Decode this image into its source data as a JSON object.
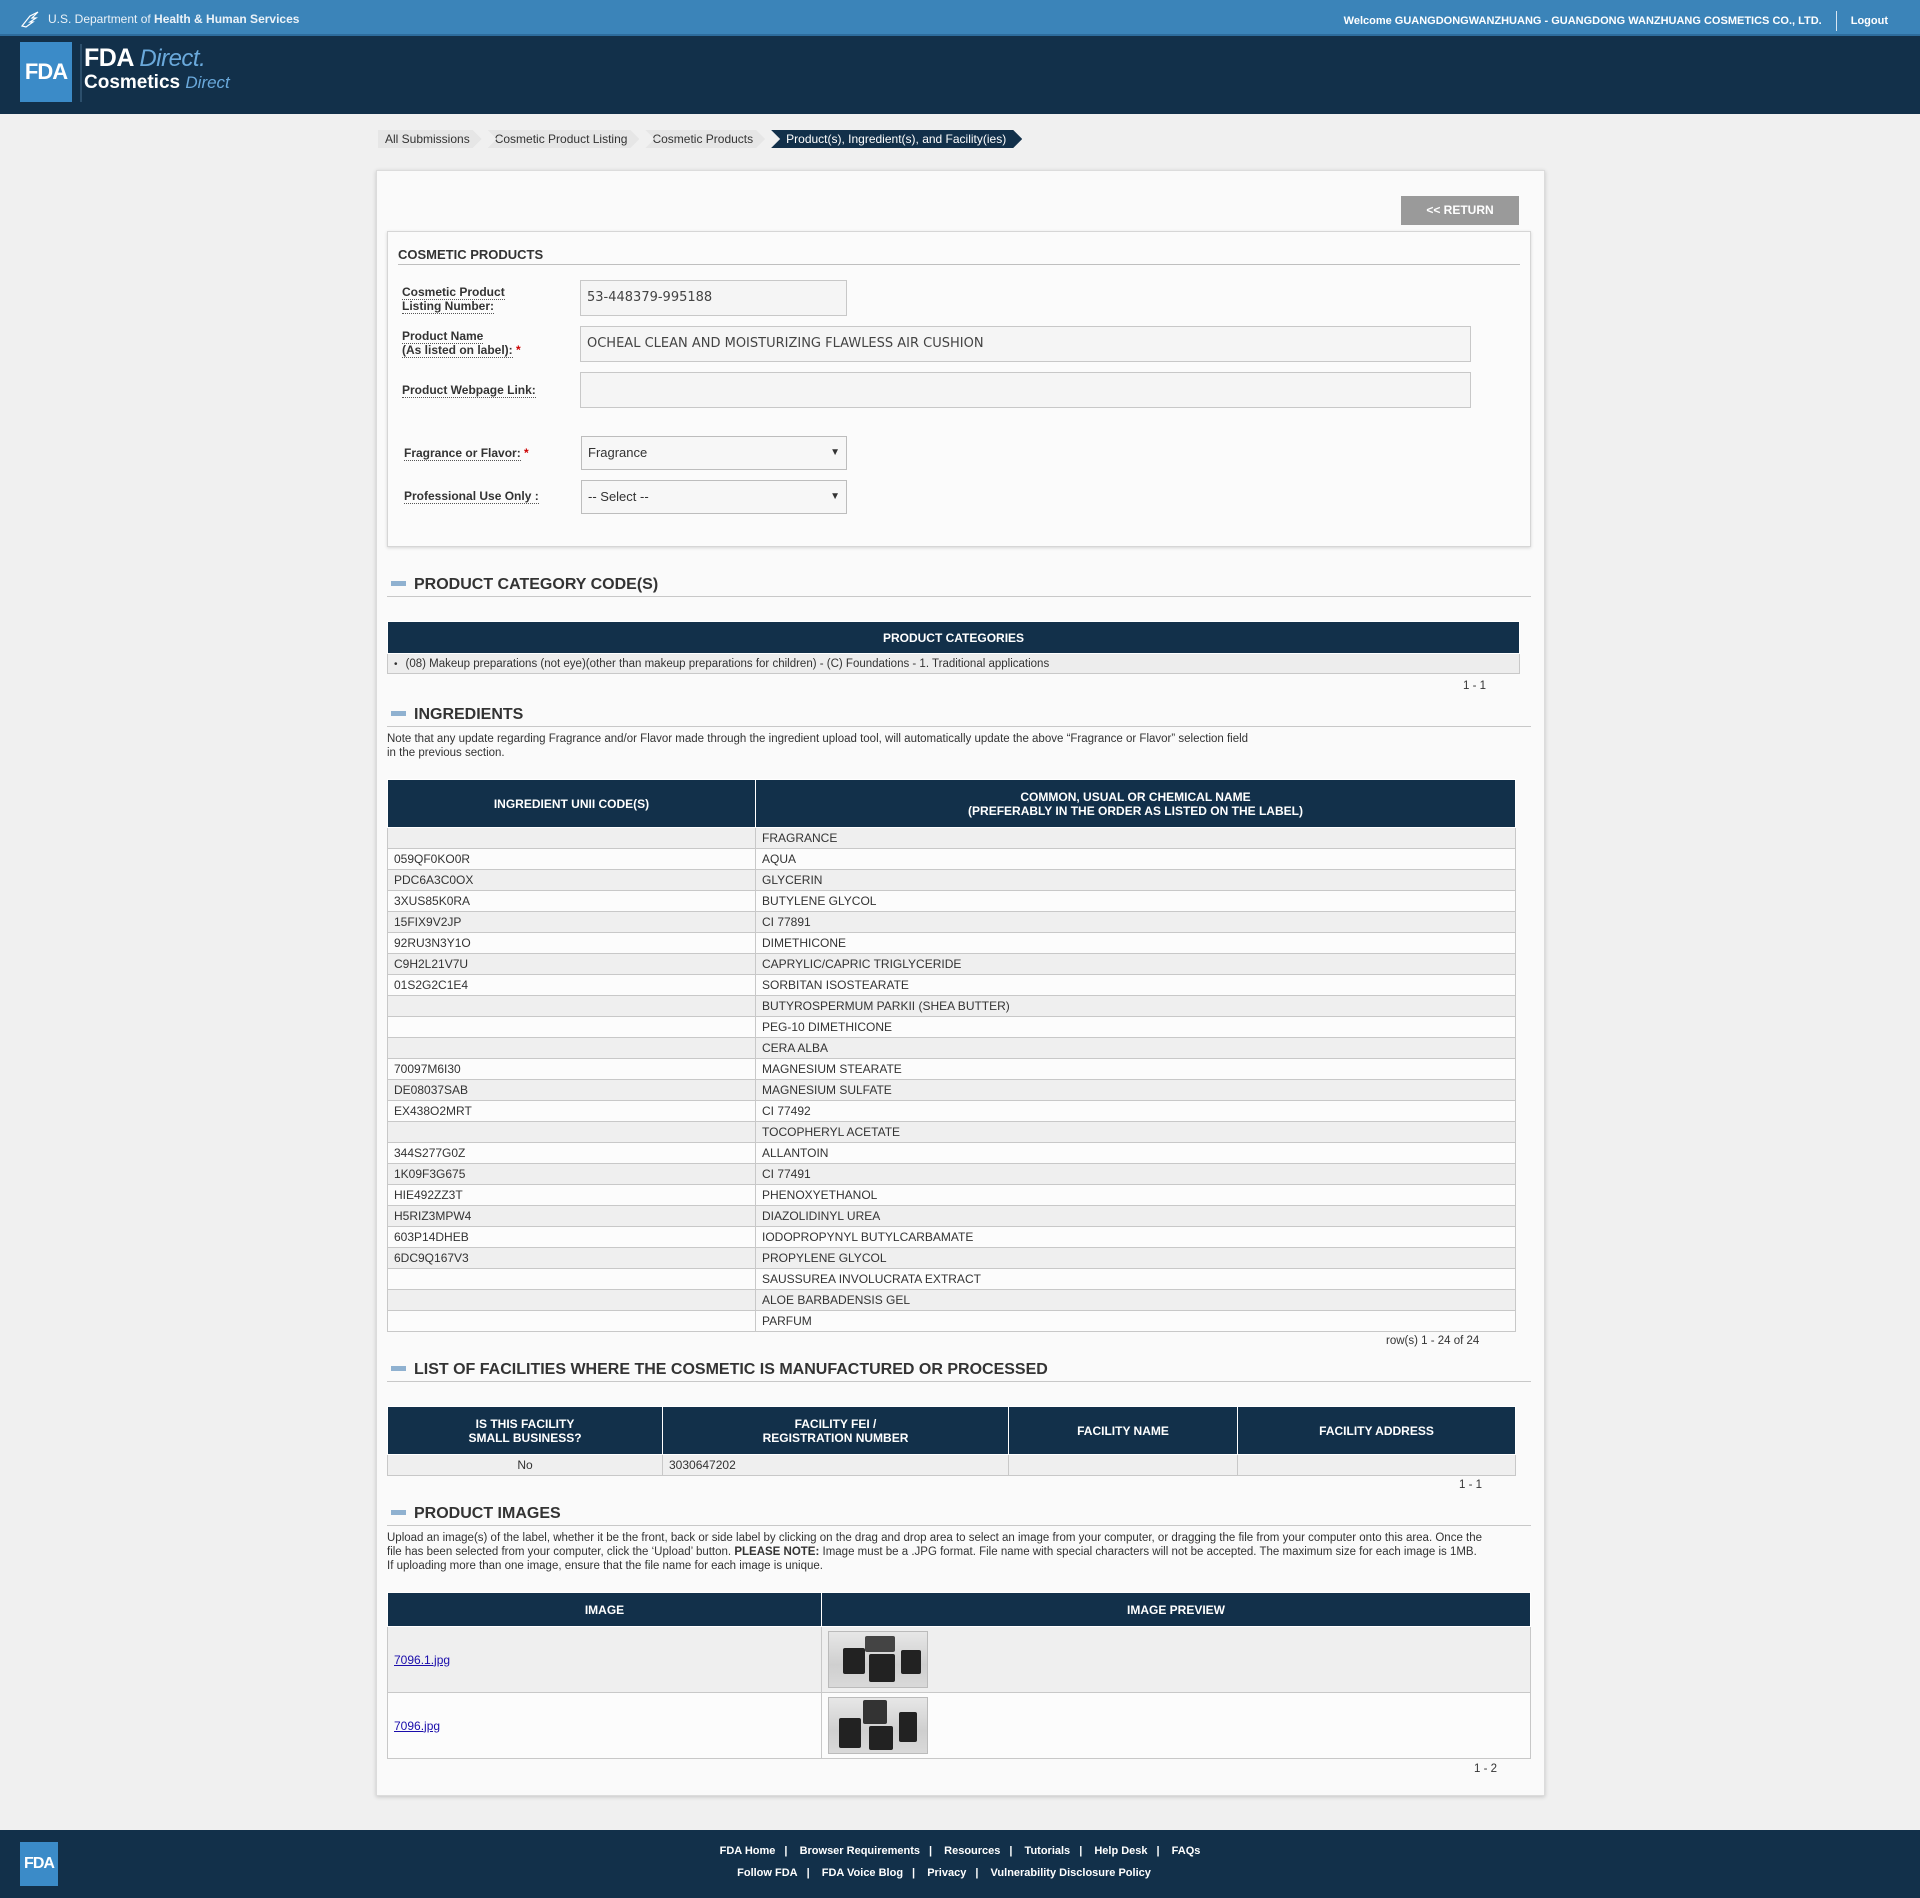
{
  "topbar": {
    "agency_prefix": "U.S. Department of ",
    "agency_name": "Health & Human Services",
    "welcome": "Welcome GUANGDONGWANZHUANG - GUANGDONG WANZHUANG COSMETICS CO., LTD.",
    "logout": "Logout"
  },
  "header": {
    "logo_text": "FDA",
    "brand_line1_a": "FDA",
    "brand_line1_b": "Direct",
    "brand_line1_c": ".",
    "brand_line2_a": "Cosmetics",
    "brand_line2_b": "Direct"
  },
  "breadcrumb": [
    "All Submissions",
    "Cosmetic Product Listing",
    "Cosmetic Products",
    "Product(s), Ingredient(s), and Facility(ies)"
  ],
  "return_label": "<< RETURN",
  "form": {
    "title": "COSMETIC PRODUCTS",
    "listing_label_1": "Cosmetic Product",
    "listing_label_2": "Listing Number:",
    "listing_value": "53-448379-995188",
    "product_name_label_1": "Product Name",
    "product_name_label_2": "(As listed on label):",
    "product_name_value": "OCHEAL CLEAN AND MOISTURIZING FLAWLESS AIR CUSHION",
    "webpage_label": "Product Webpage Link:",
    "webpage_value": "",
    "fragrance_label": "Fragrance or Flavor:",
    "fragrance_value": "Fragrance",
    "professional_label": "Professional Use Only :",
    "professional_value": "-- Select --",
    "required_mark": "*"
  },
  "categories": {
    "section_title": "PRODUCT CATEGORY CODE(S)",
    "header": "PRODUCT CATEGORIES",
    "items": [
      "(08) Makeup preparations (not eye)(other than makeup preparations for children) - (C) Foundations - 1. Traditional applications"
    ],
    "pager": "1 - 1"
  },
  "ingredients": {
    "section_title": "INGREDIENTS",
    "note_line1": "Note that any update regarding Fragrance and/or Flavor made through the ingredient upload tool, will automatically update the above “Fragrance or Flavor” selection field",
    "note_line2": "in the previous section.",
    "col1": "INGREDIENT UNII CODE(S)",
    "col2_line1": "COMMON, USUAL OR CHEMICAL NAME",
    "col2_line2": "(PREFERABLY IN THE ORDER AS LISTED ON THE LABEL)",
    "rows": [
      [
        "",
        "FRAGRANCE"
      ],
      [
        "059QF0KO0R",
        "AQUA"
      ],
      [
        "PDC6A3C0OX",
        "GLYCERIN"
      ],
      [
        "3XUS85K0RA",
        "BUTYLENE GLYCOL"
      ],
      [
        "15FIX9V2JP",
        "CI 77891"
      ],
      [
        "92RU3N3Y1O",
        "DIMETHICONE"
      ],
      [
        "C9H2L21V7U",
        "CAPRYLIC/CAPRIC TRIGLYCERIDE"
      ],
      [
        "01S2G2C1E4",
        "SORBITAN ISOSTEARATE"
      ],
      [
        "",
        "BUTYROSPERMUM PARKII (SHEA BUTTER)"
      ],
      [
        "",
        "PEG-10 DIMETHICONE"
      ],
      [
        "",
        "CERA ALBA"
      ],
      [
        "70097M6I30",
        "MAGNESIUM STEARATE"
      ],
      [
        "DE08037SAB",
        "MAGNESIUM SULFATE"
      ],
      [
        "EX438O2MRT",
        "CI 77492"
      ],
      [
        "",
        "TOCOPHERYL ACETATE"
      ],
      [
        "344S277G0Z",
        "ALLANTOIN"
      ],
      [
        "1K09F3G675",
        "CI 77491"
      ],
      [
        "HIE492ZZ3T",
        "PHENOXYETHANOL"
      ],
      [
        "H5RIZ3MPW4",
        "DIAZOLIDINYL UREA"
      ],
      [
        "603P14DHEB",
        "IODOPROPYNYL BUTYLCARBAMATE"
      ],
      [
        "6DC9Q167V3",
        "PROPYLENE GLYCOL"
      ],
      [
        "",
        "SAUSSUREA INVOLUCRATA EXTRACT"
      ],
      [
        "",
        "ALOE BARBADENSIS GEL"
      ],
      [
        "",
        "PARFUM"
      ]
    ],
    "pager": "row(s) 1 - 24 of 24"
  },
  "facilities": {
    "section_title": "LIST OF FACILITIES WHERE THE COSMETIC IS MANUFACTURED OR PROCESSED",
    "col1_line1": "IS THIS FACILITY",
    "col1_line2": "SMALL BUSINESS?",
    "col2_line1": "FACILITY FEI /",
    "col2_line2": "REGISTRATION NUMBER",
    "col3": "FACILITY NAME",
    "col4": "FACILITY ADDRESS",
    "rows": [
      [
        "No",
        "3030647202",
        "",
        ""
      ]
    ],
    "pager": "1 - 1"
  },
  "images": {
    "section_title": "PRODUCT IMAGES",
    "note_line1": "Upload an image(s) of the label, whether it be the front, back or side label by clicking on the drag and drop area to select an image from your computer, or dragging the file from your computer onto this area. Once the",
    "note_line2_a": "file has been selected from your computer, click the ‘Upload’ button. ",
    "note_line2_b": "PLEASE NOTE:",
    "note_line2_c": " Image must be a .JPG format. File name with special characters will not be accepted. The maximum size for each image is 1MB.",
    "note_line3": "If uploading more than one image, ensure that the file name for each image is unique.",
    "col1": "IMAGE",
    "col2": "IMAGE PREVIEW",
    "rows": [
      "7096.1.jpg",
      "7096.jpg"
    ],
    "pager": "1 - 2"
  },
  "footer": {
    "logo_text": "FDA",
    "row1": [
      "FDA Home",
      "Browser Requirements",
      "Resources",
      "Tutorials",
      "Help Desk",
      "FAQs"
    ],
    "row2": [
      "Follow FDA",
      "FDA Voice Blog",
      "Privacy",
      "Vulnerability Disclosure Policy"
    ],
    "separator": "|"
  },
  "colors": {
    "hhs_blue": "#3b84b9",
    "navy": "#12304a",
    "accent_blue": "#3b8bc8",
    "required_red": "#cc0000"
  }
}
